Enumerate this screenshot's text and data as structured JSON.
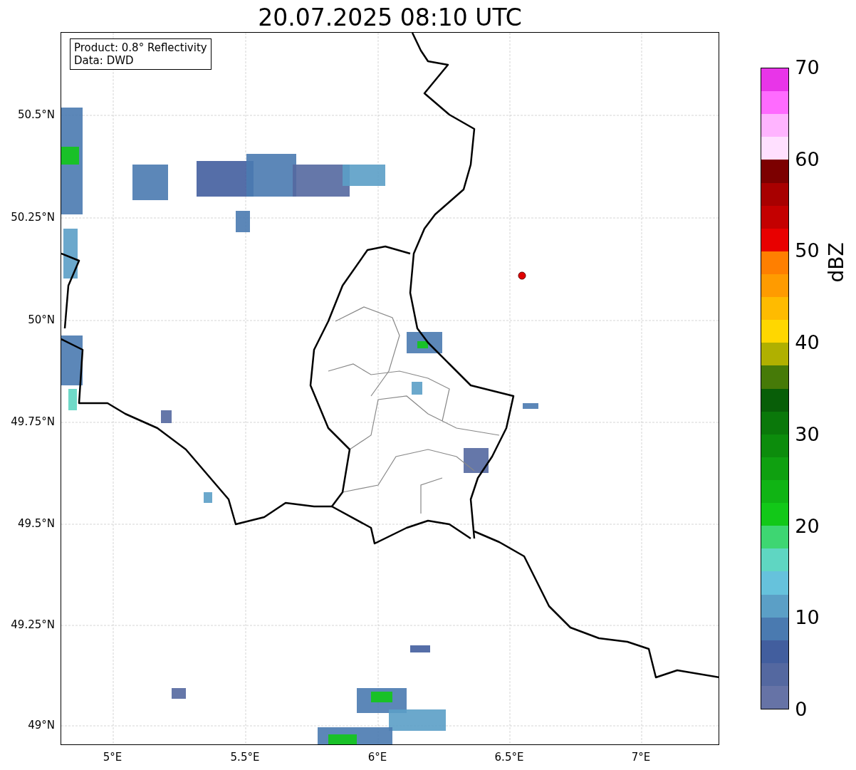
{
  "title": "20.07.2025 08:10 UTC",
  "info_box": {
    "lines": [
      "Product: 0.8° Reflectivity",
      "Data: DWD"
    ]
  },
  "map": {
    "lat_labels": [
      "50.5°N",
      "50.25°N",
      "50°N",
      "49.75°N",
      "49.5°N",
      "49.25°N",
      "49°N"
    ],
    "lon_labels": [
      "5°E",
      "5.5°E",
      "6°E",
      "6.5°E",
      "7°E"
    ]
  },
  "colorbar": {
    "label": "dBZ",
    "ticks": [
      "70",
      "60",
      "50",
      "40",
      "30",
      "20",
      "10",
      "0"
    ],
    "segments": [
      {
        "color": "#e835e8"
      },
      {
        "color": "#ff6bff"
      },
      {
        "color": "#ffb4ff"
      },
      {
        "color": "#ffe0ff"
      },
      {
        "color": "#7c0000"
      },
      {
        "color": "#a80000"
      },
      {
        "color": "#c40000"
      },
      {
        "color": "#e80000"
      },
      {
        "color": "#ff7f00"
      },
      {
        "color": "#ff9b00"
      },
      {
        "color": "#ffbb00"
      },
      {
        "color": "#ffd700"
      },
      {
        "color": "#b0b000"
      },
      {
        "color": "#467a08"
      },
      {
        "color": "#085e08"
      },
      {
        "color": "#0a780a"
      },
      {
        "color": "#0c8c0c"
      },
      {
        "color": "#0fa010"
      },
      {
        "color": "#10b414"
      },
      {
        "color": "#12c818"
      },
      {
        "color": "#3ed672"
      },
      {
        "color": "#5fd6c2"
      },
      {
        "color": "#66c2dc"
      },
      {
        "color": "#5b9fc6"
      },
      {
        "color": "#4a7ab0"
      },
      {
        "color": "#425e9e"
      },
      {
        "color": "#5468a0"
      },
      {
        "color": "#6673a6"
      }
    ]
  }
}
